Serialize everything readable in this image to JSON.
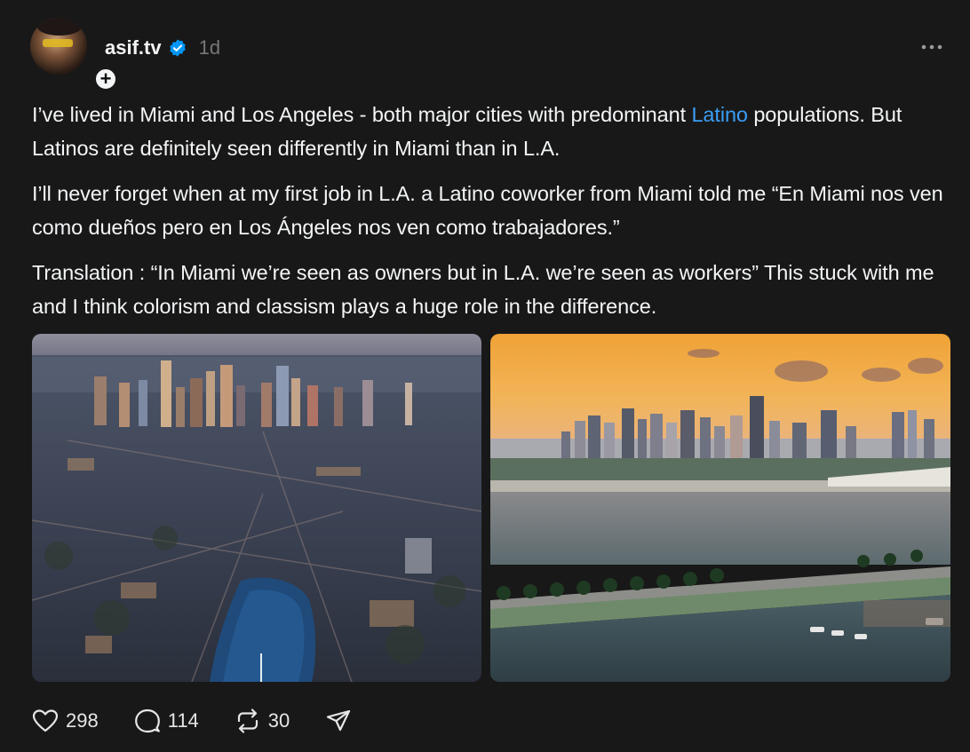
{
  "author": {
    "username": "asif.tv",
    "timestamp": "1d",
    "avatar_icon": "profile-photo",
    "follow_icon": "plus-icon",
    "verified_icon": "verified-badge-icon",
    "verified_color": "#0095f6"
  },
  "post": {
    "p1_before": "I’ve lived in Miami and Los Angeles - both major cities with predominant ",
    "p1_link": "Latino",
    "p1_after": " populations. But Latinos are definitely seen differently in Miami than in L.A.",
    "p2": "I’ll never forget when at my first job in L.A. a Latino coworker from Miami told me “En Miami nos ven como dueños pero en Los Ángeles nos ven como trabajadores.”",
    "p3": "Translation : “In Miami we’re seen as owners but in L.A. we’re seen as workers” This stuck with me and I think colorism and classism plays a huge role in the difference."
  },
  "media": [
    {
      "icon": "aerial-photo-los-angeles"
    },
    {
      "icon": "aerial-photo-miami-skyline-sunset"
    }
  ],
  "actions": {
    "likes": "298",
    "replies": "114",
    "reposts": "30",
    "like_icon": "heart-icon",
    "reply_icon": "comment-icon",
    "repost_icon": "repost-icon",
    "share_icon": "share-icon",
    "more_icon": "more-options-icon"
  },
  "colors": {
    "background": "#181818",
    "text": "#f3f5f7",
    "muted": "#777777",
    "link": "#3b9ef5"
  }
}
